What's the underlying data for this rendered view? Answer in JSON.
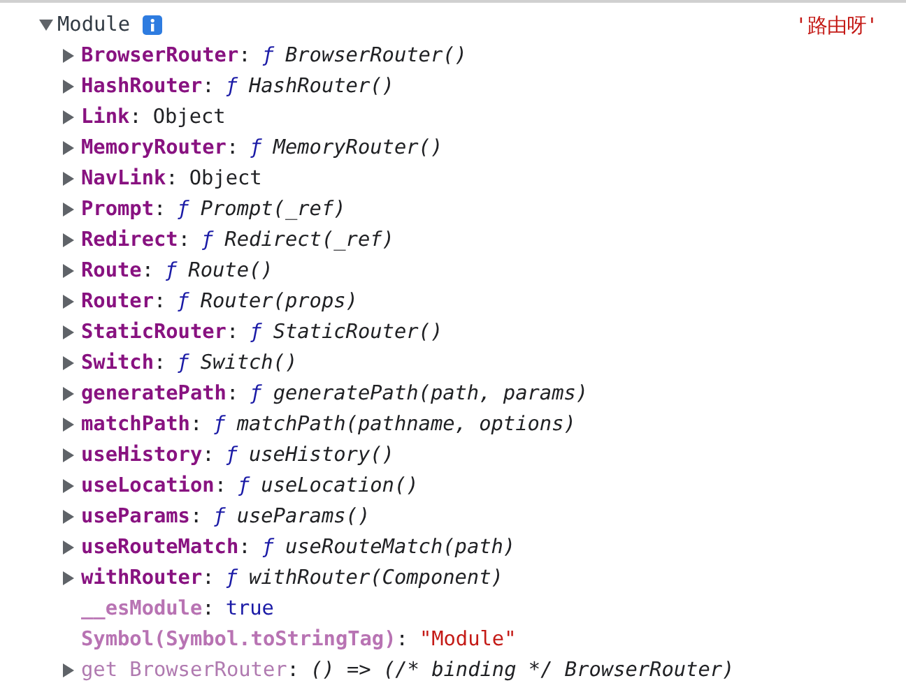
{
  "header": {
    "label": "Module",
    "expanded": true,
    "logged_string": "'路由呀'"
  },
  "properties": [
    {
      "key": "BrowserRouter",
      "separator": ":",
      "dimmed": false,
      "expandable": true,
      "kind": "function",
      "marker": "ƒ",
      "value": "BrowserRouter()"
    },
    {
      "key": "HashRouter",
      "separator": ":",
      "dimmed": false,
      "expandable": true,
      "kind": "function",
      "marker": "ƒ",
      "value": "HashRouter()"
    },
    {
      "key": "Link",
      "separator": ":",
      "dimmed": false,
      "expandable": true,
      "kind": "object",
      "value": "Object"
    },
    {
      "key": "MemoryRouter",
      "separator": ":",
      "dimmed": false,
      "expandable": true,
      "kind": "function",
      "marker": "ƒ",
      "value": "MemoryRouter()"
    },
    {
      "key": "NavLink",
      "separator": ":",
      "dimmed": false,
      "expandable": true,
      "kind": "object",
      "value": "Object"
    },
    {
      "key": "Prompt",
      "separator": ":",
      "dimmed": false,
      "expandable": true,
      "kind": "function",
      "marker": "ƒ",
      "value": "Prompt(_ref)"
    },
    {
      "key": "Redirect",
      "separator": ":",
      "dimmed": false,
      "expandable": true,
      "kind": "function",
      "marker": "ƒ",
      "value": "Redirect(_ref)"
    },
    {
      "key": "Route",
      "separator": ":",
      "dimmed": false,
      "expandable": true,
      "kind": "function",
      "marker": "ƒ",
      "value": "Route()"
    },
    {
      "key": "Router",
      "separator": ":",
      "dimmed": false,
      "expandable": true,
      "kind": "function",
      "marker": "ƒ",
      "value": "Router(props)"
    },
    {
      "key": "StaticRouter",
      "separator": ":",
      "dimmed": false,
      "expandable": true,
      "kind": "function",
      "marker": "ƒ",
      "value": "StaticRouter()"
    },
    {
      "key": "Switch",
      "separator": ":",
      "dimmed": false,
      "expandable": true,
      "kind": "function",
      "marker": "ƒ",
      "value": "Switch()"
    },
    {
      "key": "generatePath",
      "separator": ":",
      "dimmed": false,
      "expandable": true,
      "kind": "function",
      "marker": "ƒ",
      "value": "generatePath(path, params)"
    },
    {
      "key": "matchPath",
      "separator": ":",
      "dimmed": false,
      "expandable": true,
      "kind": "function",
      "marker": "ƒ",
      "value": "matchPath(pathname, options)"
    },
    {
      "key": "useHistory",
      "separator": ":",
      "dimmed": false,
      "expandable": true,
      "kind": "function",
      "marker": "ƒ",
      "value": "useHistory()"
    },
    {
      "key": "useLocation",
      "separator": ":",
      "dimmed": false,
      "expandable": true,
      "kind": "function",
      "marker": "ƒ",
      "value": "useLocation()"
    },
    {
      "key": "useParams",
      "separator": ":",
      "dimmed": false,
      "expandable": true,
      "kind": "function",
      "marker": "ƒ",
      "value": "useParams()"
    },
    {
      "key": "useRouteMatch",
      "separator": ":",
      "dimmed": false,
      "expandable": true,
      "kind": "function",
      "marker": "ƒ",
      "value": "useRouteMatch(path)"
    },
    {
      "key": "withRouter",
      "separator": ":",
      "dimmed": false,
      "expandable": true,
      "kind": "function",
      "marker": "ƒ",
      "value": "withRouter(Component)"
    },
    {
      "key": "__esModule",
      "separator": ":",
      "dimmed": true,
      "expandable": false,
      "kind": "boolean",
      "value": "true"
    },
    {
      "key": "Symbol(Symbol.toStringTag)",
      "separator": ":",
      "dimmed": true,
      "expandable": false,
      "kind": "string",
      "value": "\"Module\""
    },
    {
      "key": "get BrowserRouter",
      "separator": ":",
      "dimmed": true,
      "expandable": true,
      "kind": "getter",
      "value": "() => (/* binding */ BrowserRouter)"
    }
  ]
}
